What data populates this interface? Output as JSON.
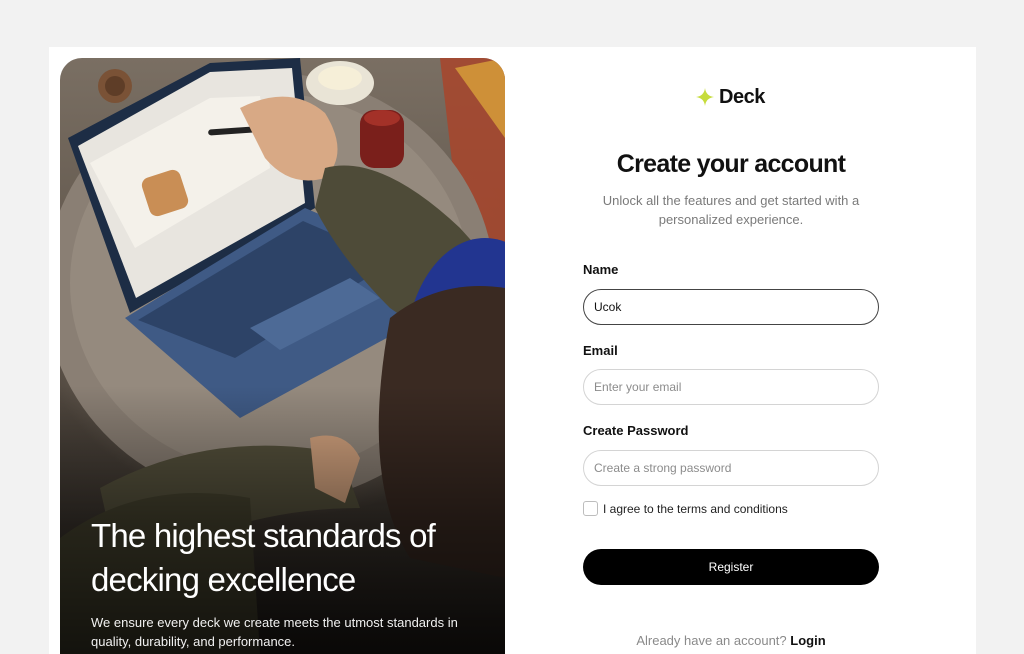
{
  "hero": {
    "title": "The highest standards of decking excellence",
    "subtitle": "We ensure every deck we create meets the utmost standards in quality, durability, and performance."
  },
  "brand": {
    "name": "Deck",
    "icon": "sparkle-icon",
    "accent": "#c6dc3c"
  },
  "form": {
    "title": "Create your account",
    "subtitle": "Unlock all the features and get started with a personalized experience.",
    "name_label": "Name",
    "name_value": "Ucok",
    "email_label": "Email",
    "email_placeholder": "Enter your email",
    "password_label": "Create Password",
    "password_placeholder": "Create a strong password",
    "terms_label": "I agree to the terms and conditions",
    "register_label": "Register",
    "login_prompt": "Already have an account?",
    "login_link": "Login"
  }
}
